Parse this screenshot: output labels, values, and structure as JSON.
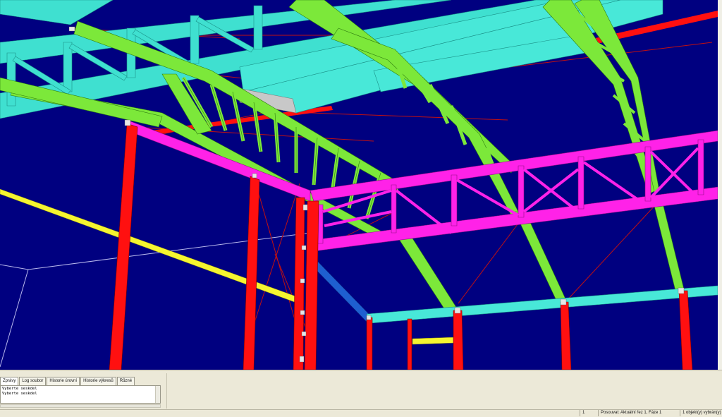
{
  "panel": {
    "tabs": [
      {
        "label": "Zprávy",
        "active": true
      },
      {
        "label": "Log soubor",
        "active": false
      },
      {
        "label": "Historie úrovní",
        "active": false
      },
      {
        "label": "Historie výkresů",
        "active": false
      },
      {
        "label": "Různé",
        "active": false
      }
    ],
    "output_lines": [
      "Vyberte seskdel",
      "Vyberte seskdel"
    ]
  },
  "status": {
    "cell1": "1",
    "cell2": "Posouvat: Aktuální řez 1, Fáze 1",
    "cell3": "1 objekt(y) vybrán(y)"
  },
  "colors": {
    "background": "#000080",
    "column": "#FF0000",
    "green_truss": "#7CE83A",
    "magenta_truss": "#FF22E8",
    "cyan_beam": "#40E0D0",
    "yellow_brace": "#F5F530",
    "blue_beam": "#1E5FD0"
  }
}
